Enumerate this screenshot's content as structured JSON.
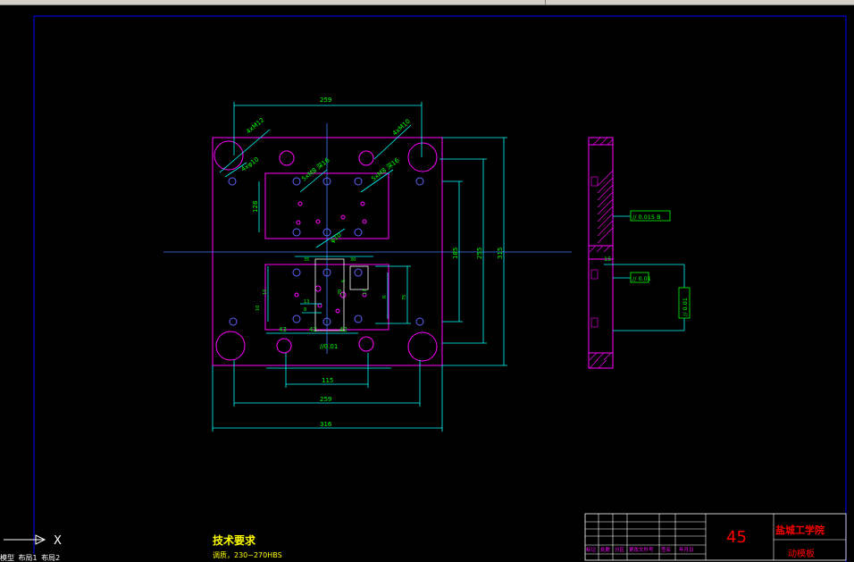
{
  "window": {
    "title": ""
  },
  "drawing": {
    "top_dims": {
      "outer_width": "259",
      "note_left": "4xM12",
      "note_right": "4xM10"
    },
    "inner_notes": {
      "left_hole": "4xφ10",
      "mid_left": "5xM8 深16",
      "mid_right": "5xM8 深16",
      "center": "φ10"
    },
    "left_dims": {
      "upper_height": "128"
    },
    "right_dims": {
      "d185": "185",
      "d255": "255",
      "d315": "315"
    },
    "bottom_dims": {
      "d43": "43",
      "d42a": "42",
      "d42b": "42",
      "d115": "115",
      "d259": "259",
      "d316": "316"
    },
    "middle_dims": {
      "a": "35",
      "b": "30",
      "c": "75",
      "d": "R",
      "e": "13",
      "f": "8",
      "g": "10",
      "h": "20",
      "i": "10",
      "j": "5",
      "k": "17"
    },
    "flatness": "//0.01",
    "side_view": {
      "tol1": "// 0.015 B",
      "tol2": "// 0.01",
      "tol3": "// 0.01",
      "dim15": "15"
    },
    "tech_title": "技术要求",
    "tech_line1": "调质，230~270HBS"
  },
  "title_block": {
    "material": "45",
    "school": "盐城工学院",
    "part": "动模板",
    "headers": [
      "标记",
      "处数",
      "分区",
      "更改文件号",
      "签名",
      "年月日"
    ]
  },
  "ucs": {
    "x_label": "X"
  },
  "layout_tabs": [
    "模型",
    "布局1",
    "布局2"
  ],
  "colors": {
    "bg": "#000000",
    "frame": "#0000ff",
    "outline": "#ff00ff",
    "dimension": "#00ffff",
    "dimtext": "#00ff00",
    "red": "#ff0000",
    "yellow": "#ffff00"
  }
}
